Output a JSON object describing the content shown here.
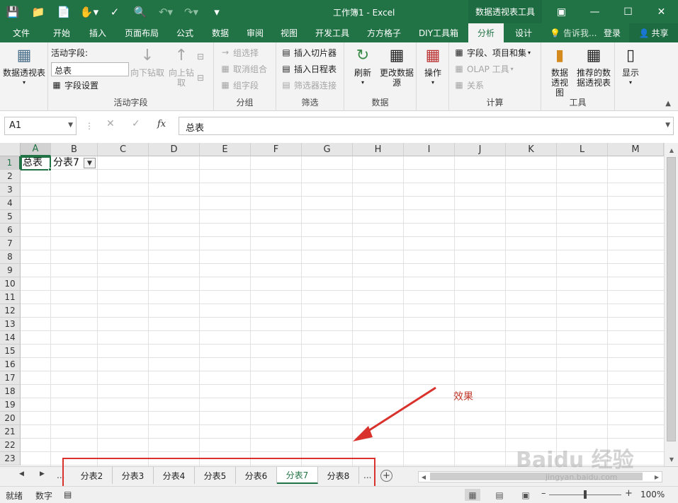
{
  "title_bar": {
    "title": "工作簿1 - Excel",
    "context_tab": "数据透视表工具"
  },
  "tabs": [
    "文件",
    "开始",
    "插入",
    "页面布局",
    "公式",
    "数据",
    "审阅",
    "视图",
    "开发工具",
    "方方格子",
    "DIY工具箱",
    "分析",
    "设计"
  ],
  "active_tab": "分析",
  "tell_me": "告诉我...",
  "login": "登录",
  "share": "共享",
  "ribbon": {
    "pivot_table": "数据透视表",
    "active_field_label": "活动字段:",
    "active_field_value": "总表",
    "field_settings": "字段设置",
    "drill_down": "向下钻取",
    "drill_up": "向上钻取",
    "group_active_field": "活动字段",
    "group_selection": "组选择",
    "ungroup": "取消组合",
    "group_field": "组字段",
    "group_group": "分组",
    "insert_slicer": "插入切片器",
    "insert_timeline": "插入日程表",
    "filter_connections": "筛选器连接",
    "group_filter": "筛选",
    "refresh": "刷新",
    "change_source": "更改数据源",
    "group_data": "数据",
    "actions": "操作",
    "fields_items_sets": "字段、项目和集",
    "olap_tools": "OLAP 工具",
    "relationships": "关系",
    "group_calc": "计算",
    "pivot_chart": "数据透视图",
    "recommended_pivot": "推荐的数据透视表",
    "group_tools": "工具",
    "show": "显示"
  },
  "formula_bar": {
    "name_box": "A1",
    "fx": "fx",
    "formula": "总表"
  },
  "grid": {
    "columns": [
      "A",
      "B",
      "C",
      "D",
      "E",
      "F",
      "G",
      "H",
      "I",
      "J",
      "K",
      "L",
      "M"
    ],
    "rows": [
      "1",
      "2",
      "3",
      "4",
      "5",
      "6",
      "7",
      "8",
      "9",
      "10",
      "11",
      "12",
      "13",
      "14",
      "15",
      "16",
      "17",
      "18",
      "19",
      "20",
      "21",
      "22",
      "23"
    ],
    "a1": "总表",
    "b1": "分表7"
  },
  "annotation": "效果",
  "sheet_tabs": [
    "分表2",
    "分表3",
    "分表4",
    "分表5",
    "分表6",
    "分表7",
    "分表8"
  ],
  "active_sheet": "分表7",
  "ellipsis": "...",
  "status": {
    "ready": "就绪",
    "num": "数字",
    "zoom": "100%"
  },
  "watermark": "Baidu 经验",
  "watermark_url": "jingyan.baidu.com",
  "colors": {
    "excel_green": "#217346",
    "annotation_red": "#d9322c"
  }
}
